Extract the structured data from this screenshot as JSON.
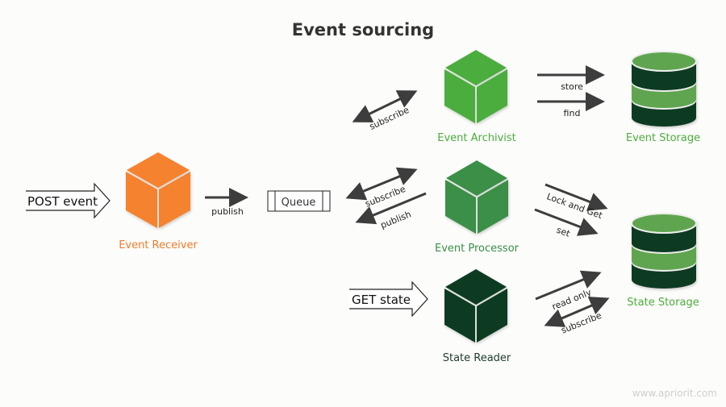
{
  "title": "Event sourcing",
  "colors": {
    "receiver": "#f5822f",
    "archivist": "#4bad3d",
    "processor": "#3a8f47",
    "reader": "#0a3a22",
    "storage_light": "#5ea550",
    "storage_dark": "#0b3a22",
    "label_orange": "#f07a2a",
    "label_green": "#4bad3d",
    "label_dark": "#1e3b2a",
    "arrow": "#3d3d3d"
  },
  "inputs": {
    "post_event": "POST event",
    "get_state": "GET state"
  },
  "queue": {
    "label": "Queue"
  },
  "nodes": {
    "event_receiver": "Event Receiver",
    "event_archivist": "Event Archivist",
    "event_processor": "Event Processor",
    "state_reader": "State Reader",
    "event_storage": "Event Storage",
    "state_storage": "State Storage"
  },
  "arrows": {
    "receiver_publish": "publish",
    "archivist_subscribe": "subscribe",
    "processor_subscribe": "subscribe",
    "processor_publish": "publish",
    "store": "store",
    "find": "find",
    "lock_and_get": "Lock and Get",
    "set": "set",
    "read_only": "read only",
    "reader_subscribe": "subscribe"
  },
  "watermark": "www.apriorit.com"
}
